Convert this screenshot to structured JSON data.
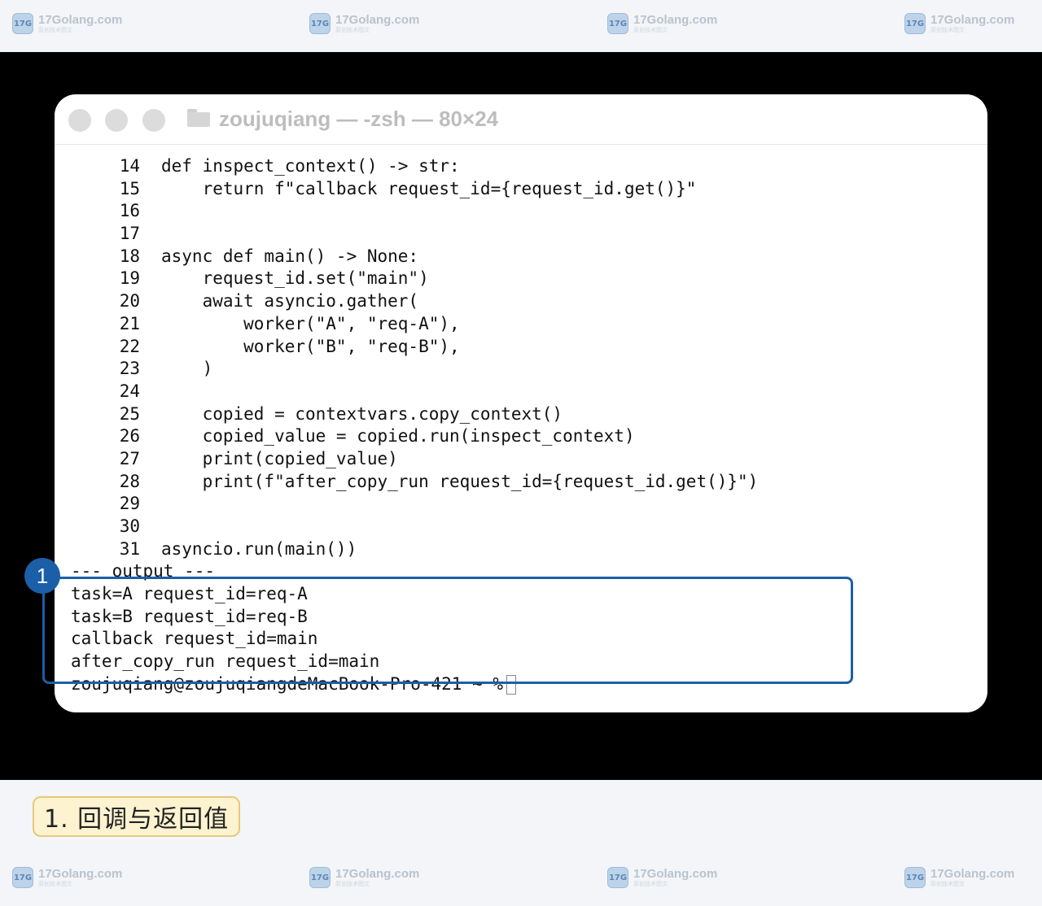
{
  "watermark": {
    "site": "17Golang.com",
    "sub": "原创技术图文",
    "logo_text": "17G"
  },
  "window": {
    "title": "zoujuqiang — -zsh — 80×24"
  },
  "code_lines": [
    {
      "num": "14",
      "code": "def inspect_context() -> str:"
    },
    {
      "num": "15",
      "code": "    return f\"callback request_id={request_id.get()}\""
    },
    {
      "num": "16",
      "code": ""
    },
    {
      "num": "17",
      "code": ""
    },
    {
      "num": "18",
      "code": "async def main() -> None:"
    },
    {
      "num": "19",
      "code": "    request_id.set(\"main\")"
    },
    {
      "num": "20",
      "code": "    await asyncio.gather("
    },
    {
      "num": "21",
      "code": "        worker(\"A\", \"req-A\"),"
    },
    {
      "num": "22",
      "code": "        worker(\"B\", \"req-B\"),"
    },
    {
      "num": "23",
      "code": "    )"
    },
    {
      "num": "24",
      "code": ""
    },
    {
      "num": "25",
      "code": "    copied = contextvars.copy_context()"
    },
    {
      "num": "26",
      "code": "    copied_value = copied.run(inspect_context)"
    },
    {
      "num": "27",
      "code": "    print(copied_value)"
    },
    {
      "num": "28",
      "code": "    print(f\"after_copy_run request_id={request_id.get()}\")"
    },
    {
      "num": "29",
      "code": ""
    },
    {
      "num": "30",
      "code": ""
    },
    {
      "num": "31",
      "code": "asyncio.run(main())"
    }
  ],
  "output_lines": [
    "--- output ---",
    "task=A request_id=req-A",
    "task=B request_id=req-B",
    "callback request_id=main",
    "after_copy_run request_id=main"
  ],
  "prompt": "zoujuqiang@zoujuqiangdeMacBook-Pro-421 ~ %",
  "annotation": {
    "badge": "1",
    "caption": "1. 回调与返回值",
    "color": "#1b5fa8"
  }
}
